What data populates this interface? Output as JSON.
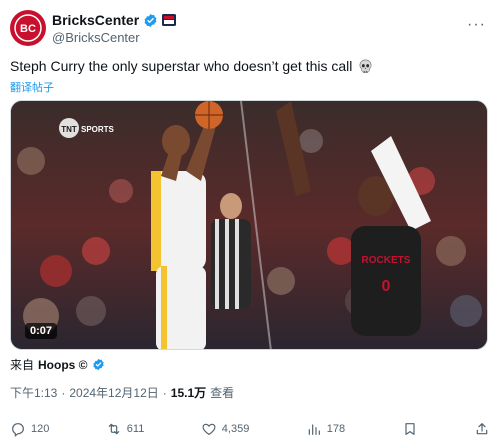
{
  "account": {
    "display_name": "BricksCenter",
    "handle": "@BricksCenter",
    "avatar_text": "BC",
    "verified_color": "#1d9bf0"
  },
  "tweet": {
    "text": "Steph Curry the only superstar who doesn’t get this call",
    "emoji": "skull-emoji",
    "translate_label": "翻译帖子"
  },
  "media": {
    "broadcaster": "TNT SPORTS",
    "duration": "0:07",
    "jersey_left": "",
    "jersey_right": "ROCKETS"
  },
  "source": {
    "prefix": "来自",
    "name": "Hoops ©"
  },
  "meta": {
    "time": "下午1:13",
    "sep1": "·",
    "date": "2024年12月12日",
    "sep2": "·",
    "views": "15.1万",
    "views_label": "查看"
  },
  "actions": {
    "reply_count": "120",
    "retweet_count": "611",
    "like_count": "4,359",
    "bookmark_count": "178"
  },
  "colors": {
    "accent": "#1d9bf0",
    "brand_red": "#c8102e"
  }
}
